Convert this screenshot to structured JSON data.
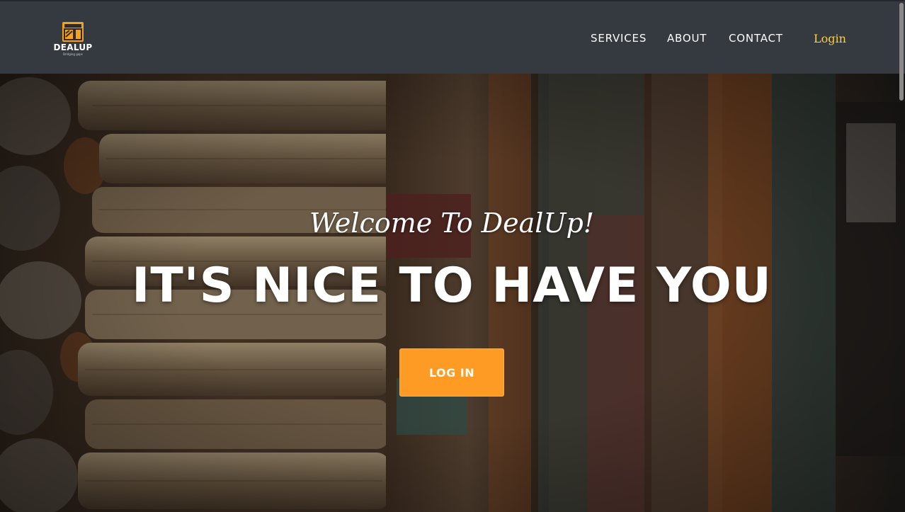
{
  "brand": {
    "name": "DEALUP",
    "tagline": "Bridging gaps",
    "accent_color": "#fe9b25",
    "icon": "storefront-logo-icon"
  },
  "nav": {
    "links": [
      {
        "label": "SERVICES"
      },
      {
        "label": "ABOUT"
      },
      {
        "label": "CONTACT"
      }
    ],
    "login_label": "Login",
    "login_color": "#fed136",
    "background": "#343a40"
  },
  "hero": {
    "subheading": "Welcome To DealUp!",
    "heading": "IT'S NICE TO HAVE YOU",
    "button_label": "LOG IN",
    "background_image": "stacked-old-books-photo"
  }
}
